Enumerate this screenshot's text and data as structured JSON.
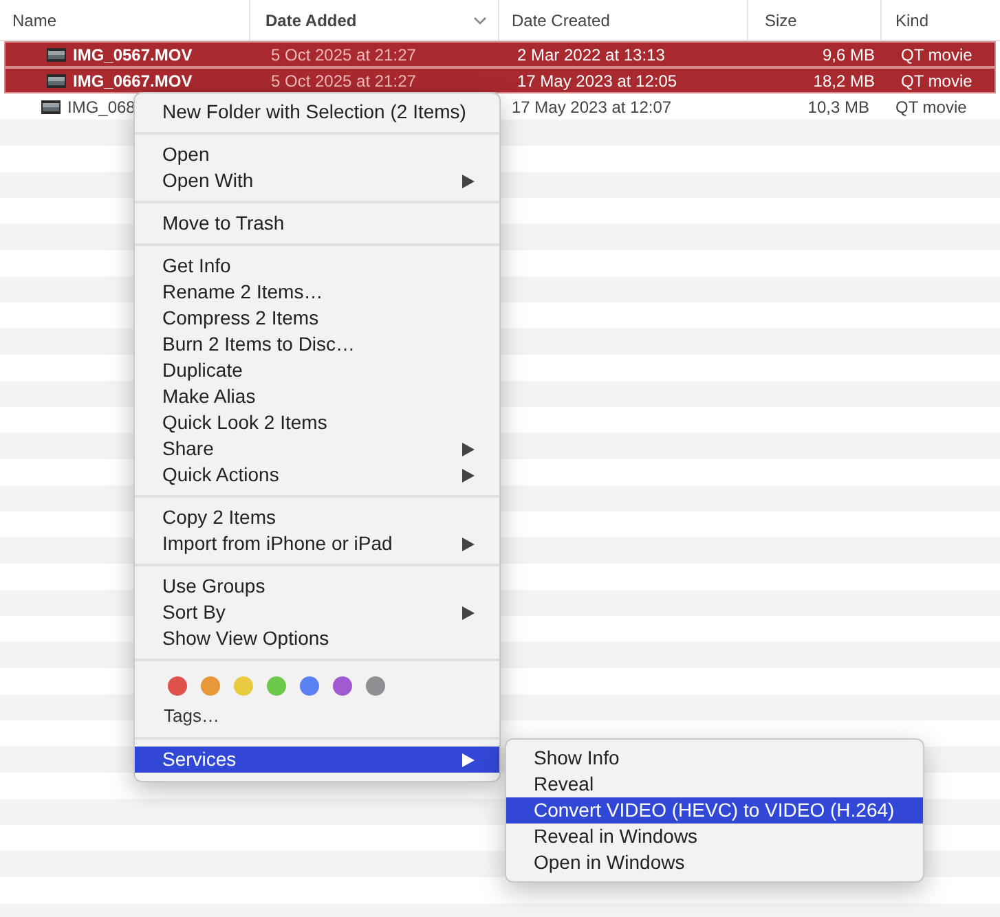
{
  "columns": [
    {
      "label": "Name",
      "sorted": false
    },
    {
      "label": "Date Added",
      "sorted": true
    },
    {
      "label": "Date Created",
      "sorted": false
    },
    {
      "label": "Size",
      "sorted": false
    },
    {
      "label": "Kind",
      "sorted": false
    }
  ],
  "rows": [
    {
      "name": "IMG_0567.MOV",
      "date_added": "5 Oct 2025 at 21:27",
      "date_created": "2 Mar 2022 at 13:13",
      "size": "9,6 MB",
      "kind": "QT movie",
      "selected": true
    },
    {
      "name": "IMG_0667.MOV",
      "date_added": "5 Oct 2025 at 21:27",
      "date_created": "17 May 2023 at 12:05",
      "size": "18,2 MB",
      "kind": "QT movie",
      "selected": true
    },
    {
      "name": "IMG_068",
      "date_created": "17 May 2023 at 12:07",
      "size": "10,3 MB",
      "kind": "QT movie",
      "selected": false
    }
  ],
  "context_menu": {
    "sections": [
      {
        "kind": "items",
        "items": [
          {
            "label": "New Folder with Selection (2 Items)",
            "submenu": false,
            "selected": false
          }
        ]
      },
      {
        "kind": "items",
        "items": [
          {
            "label": "Open",
            "submenu": false,
            "selected": false
          },
          {
            "label": "Open With",
            "submenu": true,
            "selected": false
          }
        ]
      },
      {
        "kind": "items",
        "items": [
          {
            "label": "Move to Trash",
            "submenu": false,
            "selected": false
          }
        ]
      },
      {
        "kind": "items",
        "items": [
          {
            "label": "Get Info",
            "submenu": false,
            "selected": false
          },
          {
            "label": "Rename 2 Items…",
            "submenu": false,
            "selected": false
          },
          {
            "label": "Compress 2 Items",
            "submenu": false,
            "selected": false
          },
          {
            "label": "Burn 2 Items to Disc…",
            "submenu": false,
            "selected": false
          },
          {
            "label": "Duplicate",
            "submenu": false,
            "selected": false
          },
          {
            "label": "Make Alias",
            "submenu": false,
            "selected": false
          },
          {
            "label": "Quick Look 2 Items",
            "submenu": false,
            "selected": false
          },
          {
            "label": "Share",
            "submenu": true,
            "selected": false
          },
          {
            "label": "Quick Actions",
            "submenu": true,
            "selected": false
          }
        ]
      },
      {
        "kind": "items",
        "items": [
          {
            "label": "Copy 2 Items",
            "submenu": false,
            "selected": false
          },
          {
            "label": "Import from iPhone or iPad",
            "submenu": true,
            "selected": false
          }
        ]
      },
      {
        "kind": "items",
        "items": [
          {
            "label": "Use Groups",
            "submenu": false,
            "selected": false
          },
          {
            "label": "Sort By",
            "submenu": true,
            "selected": false
          },
          {
            "label": "Show View Options",
            "submenu": false,
            "selected": false
          }
        ]
      },
      {
        "kind": "tags",
        "colors": [
          {
            "color": "#e0524c"
          },
          {
            "color": "#e8973a"
          },
          {
            "color": "#e9cb3f"
          },
          {
            "color": "#6cc94c"
          },
          {
            "color": "#5b82f4"
          },
          {
            "color": "#a05ad2"
          },
          {
            "color": "#8e8e93"
          }
        ],
        "label": "Tags…"
      },
      {
        "kind": "items",
        "items": [
          {
            "label": "Services",
            "submenu": true,
            "selected": true
          }
        ]
      }
    ]
  },
  "submenu": {
    "items": [
      {
        "label": "Show Info",
        "selected": false
      },
      {
        "label": "Reveal",
        "selected": false
      },
      {
        "label": "Convert VIDEO (HEVC) to VIDEO (H.264)",
        "selected": true
      },
      {
        "label": "Reveal in Windows",
        "selected": false
      },
      {
        "label": "Open in Windows",
        "selected": false
      }
    ]
  }
}
